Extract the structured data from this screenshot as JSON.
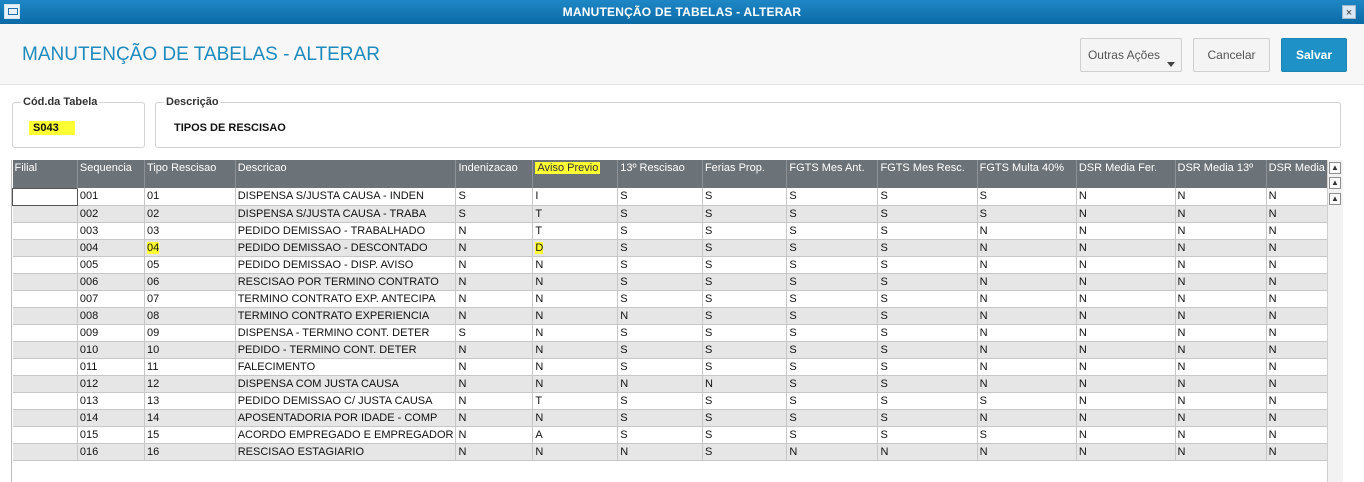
{
  "window": {
    "title": "MANUTENÇÃO DE TABELAS - ALTERAR",
    "close_label": "×"
  },
  "header": {
    "title": "MANUTENÇÃO DE TABELAS - ALTERAR",
    "buttons": {
      "more": "Outras Ações",
      "cancel": "Cancelar",
      "save": "Salvar"
    }
  },
  "form": {
    "code_label": "Cód.da Tabela",
    "code_value": "S043",
    "desc_label": "Descrição",
    "desc_value": "TIPOS DE RESCISAO"
  },
  "grid": {
    "columns": [
      "Filial",
      "Sequencia",
      "Tipo Rescisao",
      "Descricao",
      "Indenizacao",
      "Aviso Previo",
      "13º Rescisao",
      "Ferias Prop.",
      "FGTS Mes Ant.",
      "FGTS Mes Resc.",
      "FGTS Multa 40%",
      "DSR Media Fer.",
      "DSR Media 13º",
      "DSR Media"
    ],
    "rows": [
      [
        "",
        "001",
        "01",
        "DISPENSA S/JUSTA CAUSA - INDEN",
        "S",
        "I",
        "S",
        "S",
        "S",
        "S",
        "S",
        "N",
        "N",
        "N"
      ],
      [
        "",
        "002",
        "02",
        "DISPENSA S/JUSTA CAUSA - TRABA",
        "S",
        "T",
        "S",
        "S",
        "S",
        "S",
        "S",
        "N",
        "N",
        "N"
      ],
      [
        "",
        "003",
        "03",
        "PEDIDO DEMISSAO - TRABALHADO",
        "N",
        "T",
        "S",
        "S",
        "S",
        "S",
        "N",
        "N",
        "N",
        "N"
      ],
      [
        "",
        "004",
        "04",
        "PEDIDO DEMISSAO - DESCONTADO",
        "N",
        "D",
        "S",
        "S",
        "S",
        "S",
        "N",
        "N",
        "N",
        "N"
      ],
      [
        "",
        "005",
        "05",
        "PEDIDO DEMISSAO - DISP. AVISO",
        "N",
        "N",
        "S",
        "S",
        "S",
        "S",
        "N",
        "N",
        "N",
        "N"
      ],
      [
        "",
        "006",
        "06",
        "RESCISAO POR TERMINO CONTRATO",
        "N",
        "N",
        "S",
        "S",
        "S",
        "S",
        "N",
        "N",
        "N",
        "N"
      ],
      [
        "",
        "007",
        "07",
        "TERMINO CONTRATO EXP. ANTECIPA",
        "N",
        "N",
        "S",
        "S",
        "S",
        "S",
        "N",
        "N",
        "N",
        "N"
      ],
      [
        "",
        "008",
        "08",
        "TERMINO CONTRATO EXPERIENCIA",
        "N",
        "N",
        "N",
        "S",
        "S",
        "S",
        "N",
        "N",
        "N",
        "N"
      ],
      [
        "",
        "009",
        "09",
        "DISPENSA - TERMINO CONT. DETER",
        "S",
        "N",
        "S",
        "S",
        "S",
        "S",
        "N",
        "N",
        "N",
        "N"
      ],
      [
        "",
        "010",
        "10",
        "PEDIDO - TERMINO CONT. DETER",
        "N",
        "N",
        "S",
        "S",
        "S",
        "S",
        "N",
        "N",
        "N",
        "N"
      ],
      [
        "",
        "011",
        "11",
        "FALECIMENTO",
        "N",
        "N",
        "S",
        "S",
        "S",
        "S",
        "N",
        "N",
        "N",
        "N"
      ],
      [
        "",
        "012",
        "12",
        "DISPENSA COM JUSTA CAUSA",
        "N",
        "N",
        "N",
        "N",
        "S",
        "S",
        "N",
        "N",
        "N",
        "N"
      ],
      [
        "",
        "013",
        "13",
        "PEDIDO DEMISSAO C/ JUSTA CAUSA",
        "N",
        "T",
        "S",
        "S",
        "S",
        "S",
        "S",
        "N",
        "N",
        "N"
      ],
      [
        "",
        "014",
        "14",
        "APOSENTADORIA POR IDADE - COMP",
        "N",
        "N",
        "S",
        "S",
        "S",
        "S",
        "N",
        "N",
        "N",
        "N"
      ],
      [
        "",
        "015",
        "15",
        "ACORDO EMPREGADO E EMPREGADOR",
        "N",
        "A",
        "S",
        "S",
        "S",
        "S",
        "S",
        "N",
        "N",
        "N"
      ],
      [
        "",
        "016",
        "16",
        "RESCISAO ESTAGIARIO",
        "N",
        "N",
        "N",
        "S",
        "N",
        "N",
        "N",
        "N",
        "N",
        "N"
      ]
    ]
  },
  "highlights": {
    "color": "#ffff33",
    "header_col": 5,
    "cells": [
      [
        3,
        2
      ],
      [
        3,
        5
      ]
    ]
  },
  "scroll_buttons": [
    "▲",
    "▲",
    "▲"
  ]
}
